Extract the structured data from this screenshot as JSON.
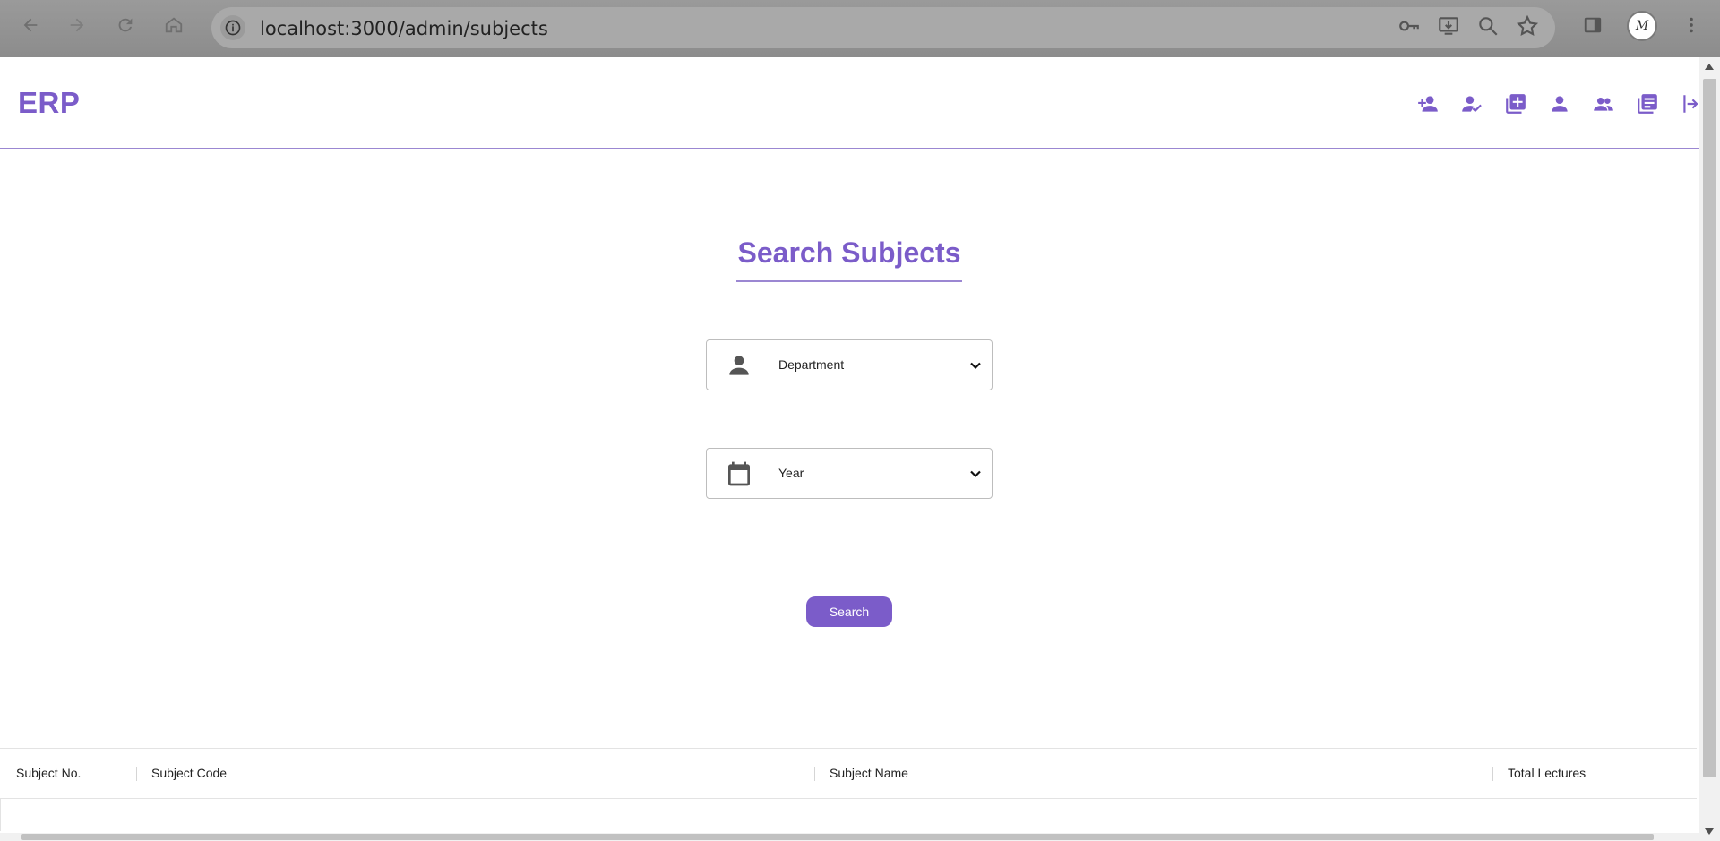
{
  "browser": {
    "url": "localhost:3000/admin/subjects",
    "avatar_text": "M"
  },
  "header": {
    "brand": "ERP",
    "icons": [
      "add-user-icon",
      "user-check-icon",
      "add-box-icon",
      "person-icon",
      "people-icon",
      "library-books-icon",
      "logout-icon"
    ]
  },
  "main": {
    "title": "Search Subjects",
    "department_select": {
      "selected": "Department",
      "icon": "person-icon"
    },
    "year_select": {
      "selected": "Year",
      "icon": "calendar-icon"
    },
    "search_label": "Search"
  },
  "table": {
    "columns": [
      "Subject No.",
      "Subject Code",
      "Subject Name",
      "Total Lectures"
    ]
  },
  "colors": {
    "accent": "#7b5cc9",
    "accent_light": "#9b87d2"
  }
}
